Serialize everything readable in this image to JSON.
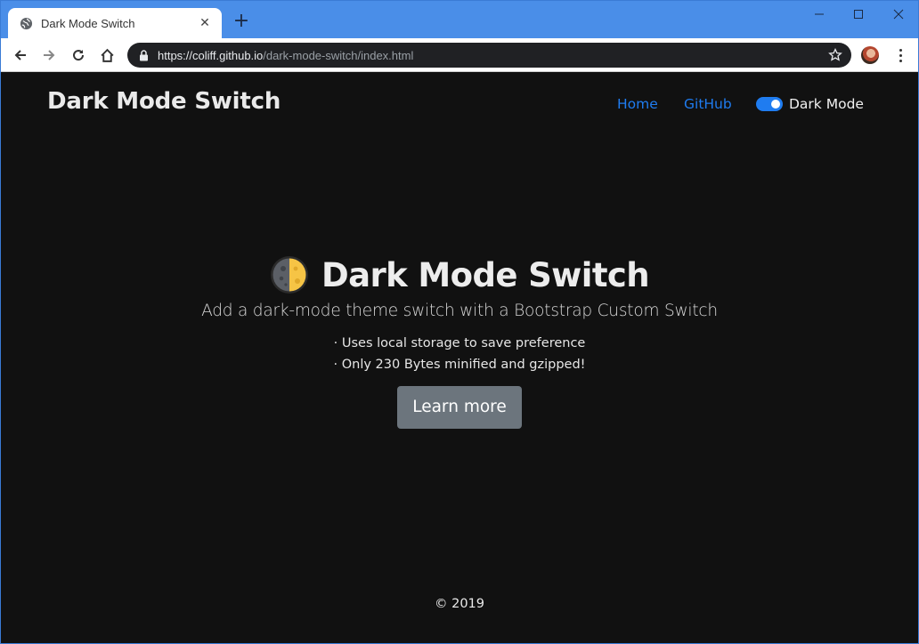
{
  "browser": {
    "tab": {
      "title": "Dark Mode Switch",
      "close_glyph": "✕"
    },
    "new_tab_glyph": "+",
    "url": {
      "host": "https://coliff.github.io",
      "path": "/dark-mode-switch/index.html"
    },
    "icons": [
      "globe-icon",
      "back-icon",
      "forward-icon",
      "reload-icon",
      "home-icon",
      "lock-icon",
      "star-icon",
      "avatar",
      "menu-icon",
      "minimize-icon",
      "maximize-icon",
      "close-icon"
    ]
  },
  "navbar": {
    "brand": "Dark Mode Switch",
    "links": [
      "Home",
      "GitHub"
    ],
    "switch_label": "Dark Mode",
    "switch_on": true
  },
  "hero": {
    "title": "Dark Mode Switch",
    "lead": "Add a dark-mode theme switch with a Bootstrap Custom Switch",
    "features": [
      "· Uses local storage to save preference",
      "· Only 230 Bytes minified and gzipped!"
    ],
    "button": "Learn more"
  },
  "footer": {
    "text": "© 2019"
  },
  "colors": {
    "background": "#111111",
    "link": "#1f7cf0",
    "button": "#6c757d",
    "chrome": "#4a8ee8"
  }
}
